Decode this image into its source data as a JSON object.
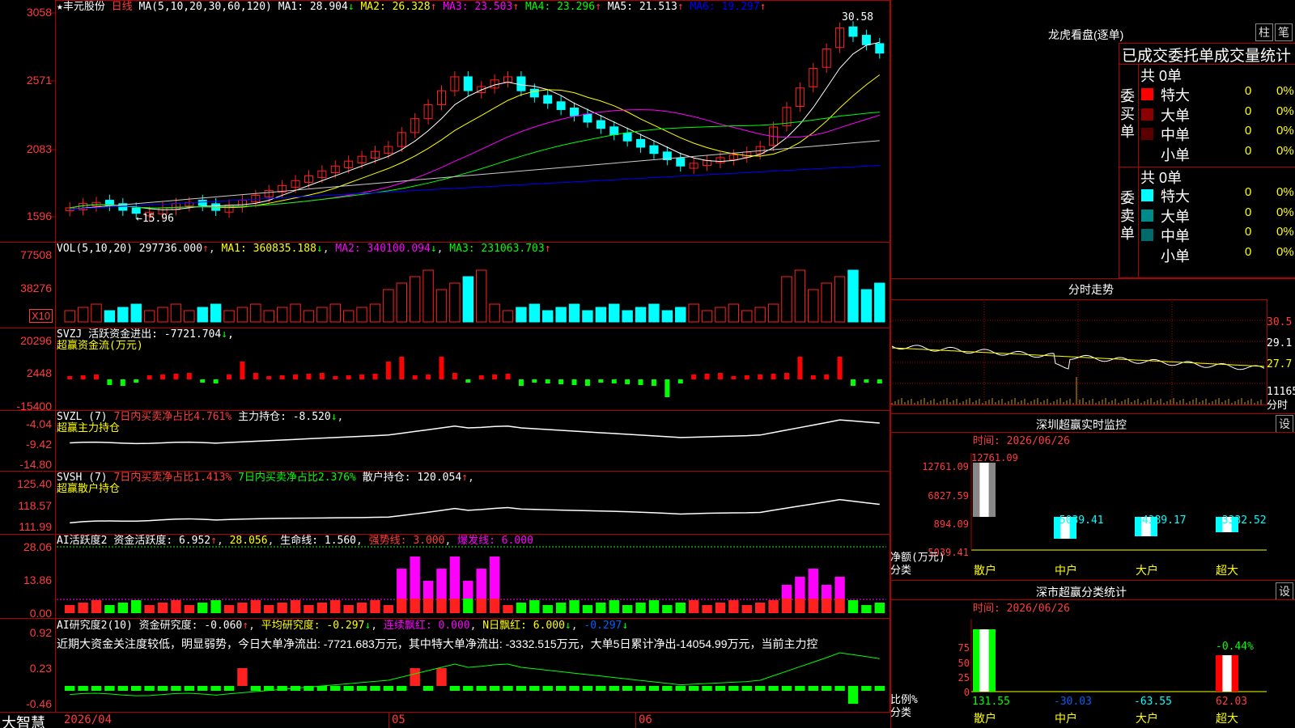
{
  "app": {
    "logo": "大智慧"
  },
  "stock": {
    "star": "★",
    "name": "丰元股份",
    "period": "日线",
    "ma_params": "MA(5,10,20,30,60,120)",
    "ma_values": [
      {
        "label": "MA1: 28.904",
        "arrow": "↓",
        "color": "#ffffff"
      },
      {
        "label": "MA2: 26.328",
        "arrow": "↑",
        "color": "#ffff00"
      },
      {
        "label": "MA3: 23.503",
        "arrow": "↑",
        "color": "#ff00ff"
      },
      {
        "label": "MA4: 23.296",
        "arrow": "↑",
        "color": "#00ff00"
      },
      {
        "label": "MA5: 21.513",
        "arrow": "↑",
        "color": "#ffffff"
      },
      {
        "label": "MA6: 19.297",
        "arrow": "↑",
        "color": "#0000ff"
      }
    ],
    "y_ticks": [
      "3058",
      "2571",
      "2083",
      "1596"
    ],
    "high_label": "30.58",
    "low_label": "15.96"
  },
  "vol": {
    "header": "VOL(5,10,20)",
    "value": "297736.000",
    "ma1": "MA1: 360835.188",
    "ma2": "MA2: 340100.094",
    "ma3": "MA3: 231063.703",
    "y_ticks": [
      "77508",
      "38276"
    ],
    "unit": "X10"
  },
  "svzj": {
    "header": "SVZJ  活跃资金进出: -7721.704",
    "sub": "超赢资金流(万元)",
    "y_ticks": [
      "20296",
      "2448",
      "-15400"
    ]
  },
  "svzl": {
    "header": "SVZL (7)",
    "item1": "7日内买卖净占比4.761%",
    "item2": "主力持仓: -8.520",
    "sub": "超赢主力持仓",
    "y_ticks": [
      "-4.04",
      "-9.42",
      "-14.80"
    ]
  },
  "svsh": {
    "header": "SVSH (7)",
    "item1": "7日内买卖净占比1.413%",
    "item2": "7日内买卖净占比2.376%",
    "item3": "散户持仓: 120.054",
    "sub": "超赢散户持仓",
    "y_ticks": [
      "125.40",
      "118.57",
      "111.99"
    ]
  },
  "ai_active": {
    "header": "AI活跃度2",
    "item1": "资金活跃度: 6.952",
    "item2": "28.056",
    "item3": "生命线: 1.560",
    "item4": "强势线: 3.000",
    "item5": "爆发线: 6.000",
    "y_ticks": [
      "28.06",
      "13.86",
      "0.00"
    ]
  },
  "ai_research": {
    "header": "AI研究度2(10)",
    "item1": "资金研究度: -0.060",
    "item2": "平均研究度: -0.297",
    "item3": "连续飘红: 0.000",
    "item4": "N日飘红: 6.000",
    "item5": "-0.297",
    "note": "近期大资金关注度较低，明显弱势，今日大单净流出: -7721.683万元，其中特大单净流出: -3332.515万元，大单5日累计净出-14054.99万元，当前主力控",
    "y_ticks": [
      "0.92",
      "0.23",
      "-0.46"
    ]
  },
  "x_axis": {
    "labels": [
      "2026/04",
      "05",
      "06"
    ]
  },
  "right": {
    "lhb_title": "龙虎看盘(逐单)",
    "btn_zhu": "柱",
    "btn_bi": "笔",
    "tab_header": "已成交委托单成交量统计",
    "buy_group": "委买单",
    "sell_group": "委卖单",
    "buy_total": "共 0单",
    "sell_total": "共 0单",
    "buy_rows": [
      {
        "name": "特大",
        "count": "0",
        "pct": "0%",
        "color": "#ff0000"
      },
      {
        "name": "大单",
        "count": "0",
        "pct": "0%",
        "color": "#8b0000"
      },
      {
        "name": "中单",
        "count": "0",
        "pct": "0%",
        "color": "#5a0000"
      },
      {
        "name": "小单",
        "count": "0",
        "pct": "0%",
        "color": ""
      }
    ],
    "sell_rows": [
      {
        "name": "特大",
        "count": "0",
        "pct": "0%",
        "color": "#00ffff"
      },
      {
        "name": "大单",
        "count": "0",
        "pct": "0%",
        "color": "#008b8b"
      },
      {
        "name": "中单",
        "count": "0",
        "pct": "0%",
        "color": "#006b6b"
      },
      {
        "name": "小单",
        "count": "0",
        "pct": "0%",
        "color": ""
      }
    ],
    "intraday_title": "分时走势",
    "intraday_ticks": [
      "30.5",
      "29.1",
      "27.7",
      "11165"
    ],
    "intraday_unit": "分时",
    "monitor_title": "深圳超赢实时监控",
    "monitor_time": "时间: 2026/06/26",
    "monitor_btn": "设",
    "monitor_ticks": [
      "12761.09",
      "6827.59",
      "894.09",
      "-5039.41"
    ],
    "monitor_net_label": "净额(万元)",
    "monitor_cat_label": "分类",
    "monitor_top_val": "12761.09",
    "monitor_values": [
      "-5039.41",
      "-4389.17",
      "-3332.52"
    ],
    "categories": [
      "散户",
      "中户",
      "大户",
      "超大"
    ],
    "class_title": "深市超赢分类统计",
    "class_time": "时间: 2026/06/26",
    "class_btn": "设",
    "class_ticks": [
      "75",
      "50",
      "25",
      "0"
    ],
    "class_ratio_label": "比例%",
    "class_cat_label": "分类",
    "class_top_val": "-0.44%",
    "class_values": [
      "131.55",
      "-30.03",
      "-63.55",
      "62.03"
    ]
  },
  "chart_data": [
    {
      "type": "candlestick",
      "title": "丰元股份 日线",
      "ylim": [
        15.96,
        30.58
      ],
      "ohlc_daily_approx_count": 60,
      "high": 30.58,
      "low": 15.96
    }
  ]
}
